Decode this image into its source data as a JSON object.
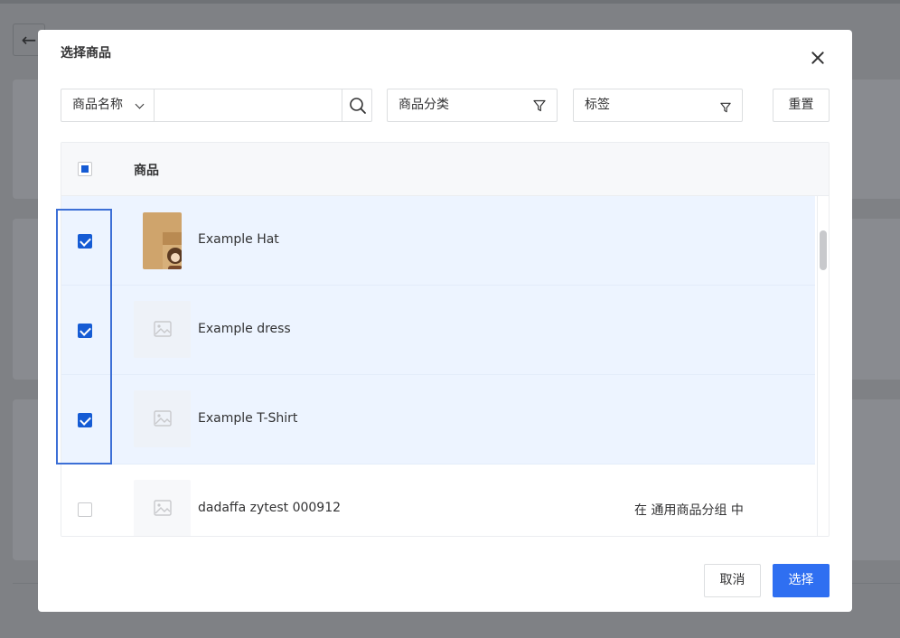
{
  "background": {
    "back_icon": "arrow-left-icon"
  },
  "dialog": {
    "title": "选择商品",
    "close_icon": "close-icon",
    "filters": {
      "field_select": "商品名称",
      "search_value": "",
      "search_icon": "search-icon",
      "category": "商品分类",
      "tag": "标签",
      "filter_icon": "filter-icon",
      "reset_label": "重置"
    },
    "table": {
      "header": "商品",
      "select_all_state": "indeterminate",
      "rows": [
        {
          "name": "Example Hat",
          "checked": true,
          "image": "photo",
          "group": ""
        },
        {
          "name": "Example dress",
          "checked": true,
          "image": "placeholder",
          "group": ""
        },
        {
          "name": "Example T-Shirt",
          "checked": true,
          "image": "placeholder",
          "group": ""
        },
        {
          "name": "dadaffa zytest 000912",
          "checked": false,
          "image": "placeholder",
          "group": "在 通用商品分组 中"
        }
      ]
    },
    "footer": {
      "cancel_label": "取消",
      "confirm_label": "选择"
    }
  },
  "colors": {
    "primary": "#2f6ff1",
    "checked": "#155bd4",
    "selected_row": "#edf4ff",
    "highlight": "#3c6fd6",
    "overlay_bg": "#7f8185"
  }
}
